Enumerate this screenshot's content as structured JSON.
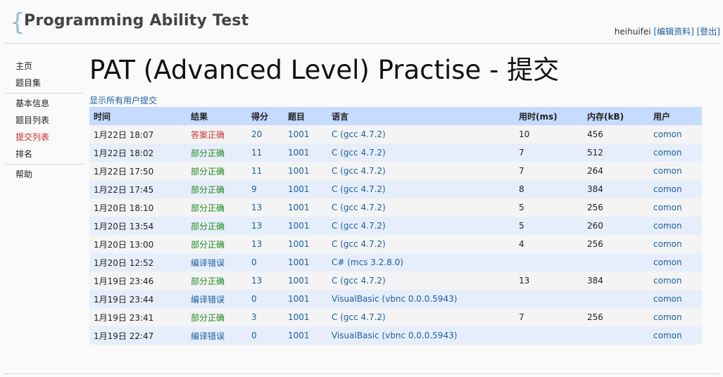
{
  "site": {
    "title": "Programming Ability Test",
    "brace": "{"
  },
  "user": {
    "name": "heihuifei",
    "edit_label": "[编辑资料]",
    "logout_label": "[登出]"
  },
  "sidebar": {
    "groups": [
      [
        {
          "label": "主页"
        },
        {
          "label": "题目集"
        }
      ],
      [
        {
          "label": "基本信息"
        },
        {
          "label": "题目列表"
        },
        {
          "label": "提交列表",
          "active": true
        },
        {
          "label": "排名"
        }
      ],
      [
        {
          "label": "帮助"
        }
      ]
    ]
  },
  "page": {
    "title": "PAT (Advanced Level) Practise - 提交",
    "show_all_label": "显示所有用户提交"
  },
  "table": {
    "columns": [
      "时间",
      "结果",
      "得分",
      "题目",
      "语言",
      "用时(ms)",
      "内存(kB)",
      "用户"
    ],
    "rows": [
      {
        "time": "1月22日 18:07",
        "result": "答案正确",
        "status": "ac",
        "score": "20",
        "problem": "1001",
        "language": "C (gcc 4.7.2)",
        "time_ms": "10",
        "memory": "456",
        "user": "comon"
      },
      {
        "time": "1月22日 18:02",
        "result": "部分正确",
        "status": "pa",
        "score": "11",
        "problem": "1001",
        "language": "C (gcc 4.7.2)",
        "time_ms": "7",
        "memory": "512",
        "user": "comon"
      },
      {
        "time": "1月22日 17:50",
        "result": "部分正确",
        "status": "pa",
        "score": "11",
        "problem": "1001",
        "language": "C (gcc 4.7.2)",
        "time_ms": "7",
        "memory": "264",
        "user": "comon"
      },
      {
        "time": "1月22日 17:45",
        "result": "部分正确",
        "status": "pa",
        "score": "9",
        "problem": "1001",
        "language": "C (gcc 4.7.2)",
        "time_ms": "8",
        "memory": "384",
        "user": "comon"
      },
      {
        "time": "1月20日 18:10",
        "result": "部分正确",
        "status": "pa",
        "score": "13",
        "problem": "1001",
        "language": "C (gcc 4.7.2)",
        "time_ms": "5",
        "memory": "256",
        "user": "comon"
      },
      {
        "time": "1月20日 13:54",
        "result": "部分正确",
        "status": "pa",
        "score": "13",
        "problem": "1001",
        "language": "C (gcc 4.7.2)",
        "time_ms": "5",
        "memory": "260",
        "user": "comon"
      },
      {
        "time": "1月20日 13:00",
        "result": "部分正确",
        "status": "pa",
        "score": "13",
        "problem": "1001",
        "language": "C (gcc 4.7.2)",
        "time_ms": "4",
        "memory": "256",
        "user": "comon"
      },
      {
        "time": "1月20日 12:52",
        "result": "编译错误",
        "status": "ce",
        "score": "0",
        "problem": "1001",
        "language": "C# (mcs 3.2.8.0)",
        "time_ms": "",
        "memory": "",
        "user": "comon"
      },
      {
        "time": "1月19日 23:46",
        "result": "部分正确",
        "status": "pa",
        "score": "13",
        "problem": "1001",
        "language": "C (gcc 4.7.2)",
        "time_ms": "13",
        "memory": "384",
        "user": "comon"
      },
      {
        "time": "1月19日 23:44",
        "result": "编译错误",
        "status": "ce",
        "score": "0",
        "problem": "1001",
        "language": "VisualBasic (vbnc 0.0.0.5943)",
        "time_ms": "",
        "memory": "",
        "user": "comon"
      },
      {
        "time": "1月19日 23:41",
        "result": "部分正确",
        "status": "pa",
        "score": "3",
        "problem": "1001",
        "language": "C (gcc 4.7.2)",
        "time_ms": "7",
        "memory": "256",
        "user": "comon"
      },
      {
        "time": "1月19日 22:47",
        "result": "编译错误",
        "status": "ce",
        "score": "0",
        "problem": "1001",
        "language": "VisualBasic (vbnc 0.0.0.5943)",
        "time_ms": "",
        "memory": "",
        "user": "comon"
      }
    ]
  },
  "colors": {
    "header_row": "#c5dbff",
    "accepted": "#d43030",
    "partial": "#1e8a1e",
    "compile_error": "#1a5fa3",
    "link": "#1a5fa3",
    "active_nav": "#cc2a2a"
  }
}
